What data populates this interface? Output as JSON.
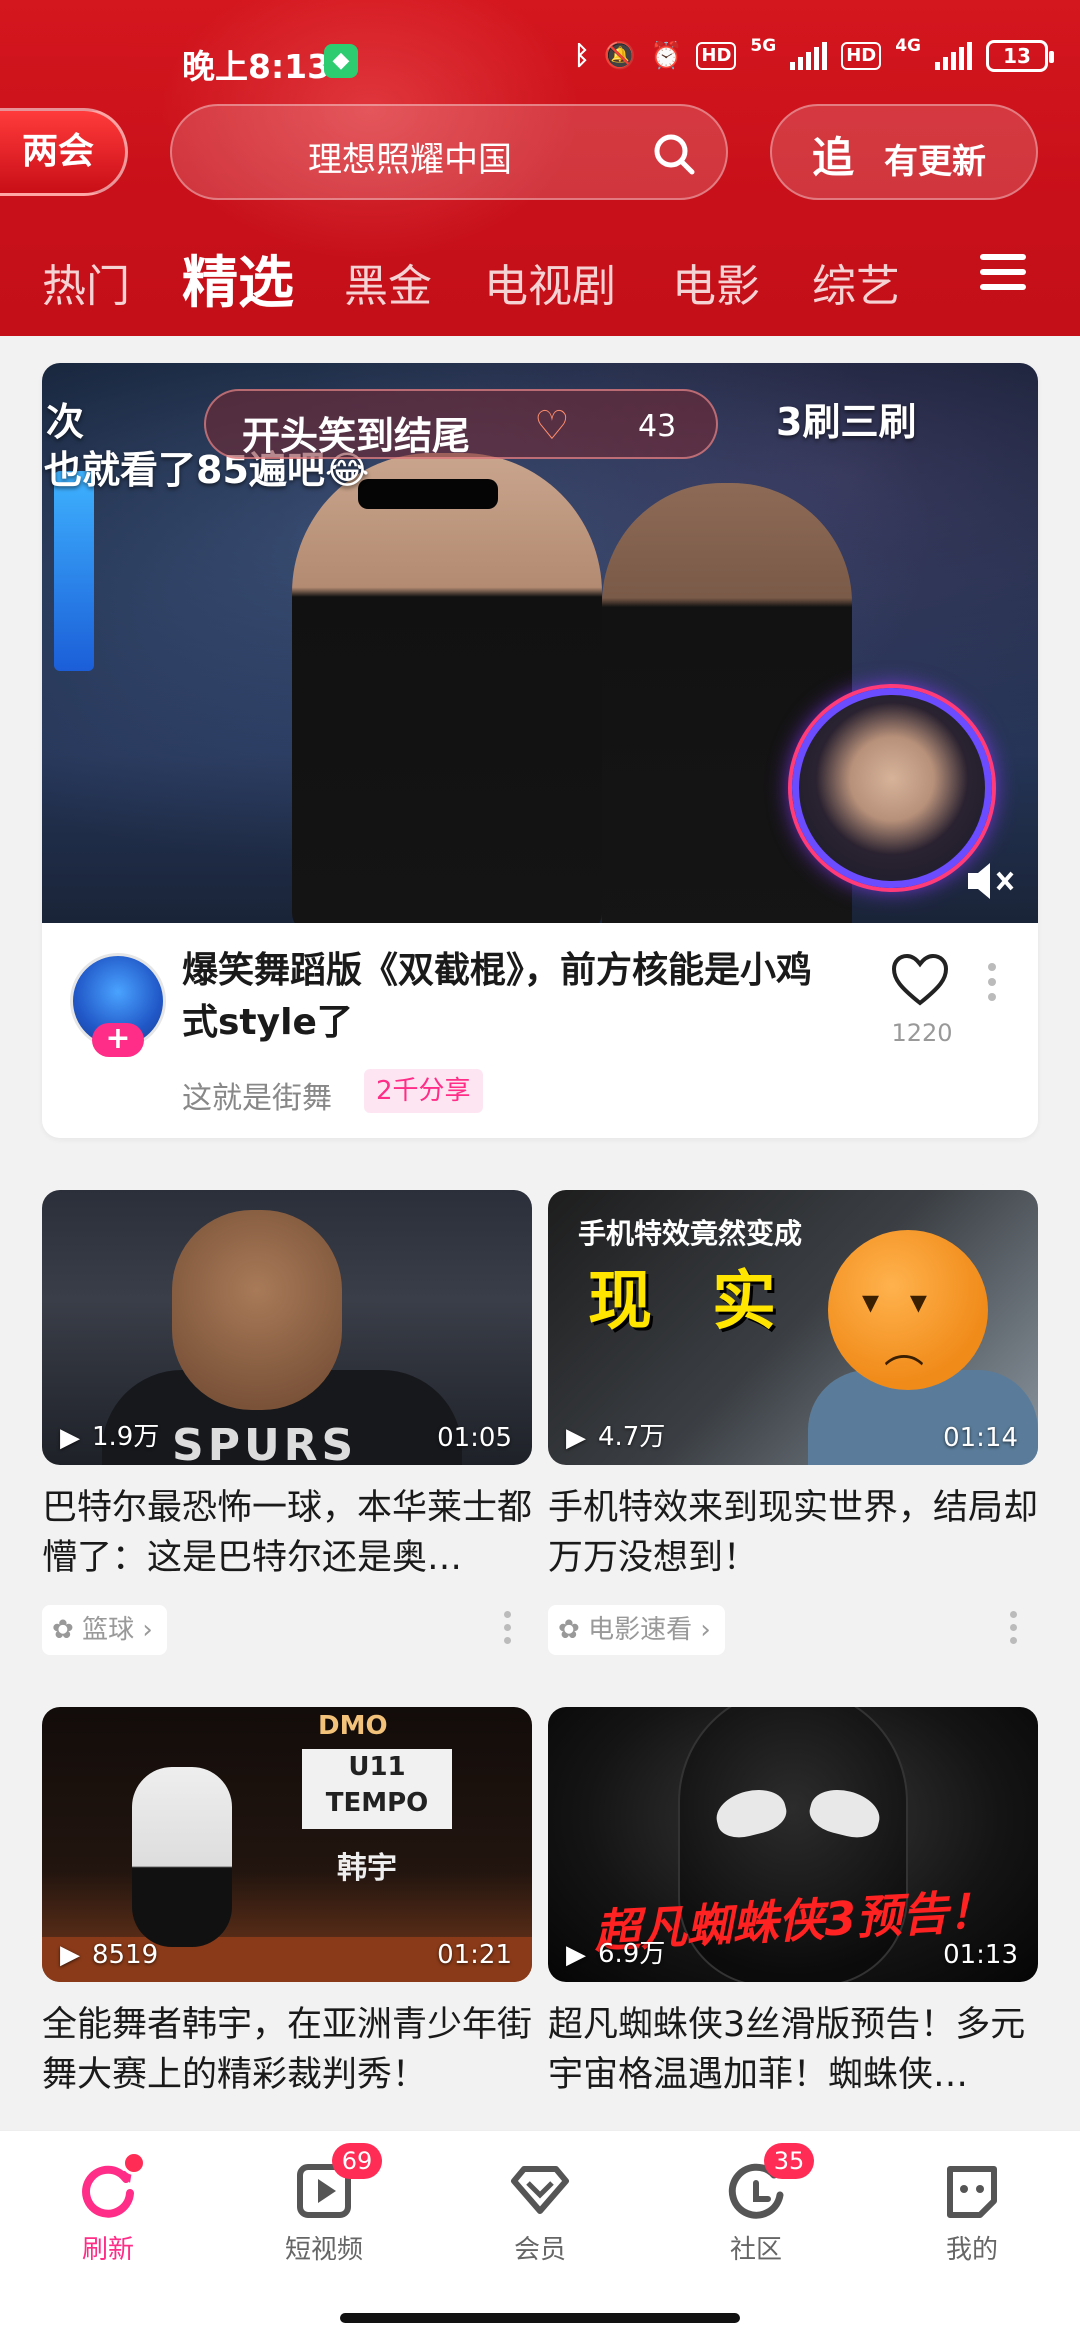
{
  "status_bar": {
    "time": "晚上8:13",
    "battery": "13",
    "hd1": "HD",
    "hd2": "HD",
    "net1": "5G",
    "net2": "4G"
  },
  "header": {
    "badge_label": "两会",
    "search_placeholder": "理想照耀中国",
    "follow_icon_text": "追",
    "follow_label": "有更新",
    "tabs": [
      "热门",
      "精选",
      "黑金",
      "电视剧",
      "电影",
      "综艺"
    ],
    "active_tab": "精选",
    "colors": {
      "header_bg": "#c8101a",
      "accent": "#ff2d87"
    }
  },
  "featured": {
    "video_caption_left": "次",
    "video_caption_line": "也就看了85遍吧😂",
    "pill_text": "开头笑到结尾",
    "pill_count": "43",
    "video_caption_right": "3刷三刷",
    "title": "爆笑舞蹈版《双截棍》，前方核能是小鸡式style了",
    "source": "这就是街舞",
    "share_tag": "2千分享",
    "likes": "1220"
  },
  "cards": [
    {
      "views": "1.9万",
      "duration": "01:05",
      "title": "巴特尔最恐怖一球，本华莱士都懵了：这是巴特尔还是奥…",
      "tag": "篮球",
      "thumb_text": "SPURS"
    },
    {
      "views": "4.7万",
      "duration": "01:14",
      "title": "手机特效来到现实世界，结局却万万没想到！",
      "tag": "电影速看",
      "thumb_line1": "手机特效竟然变成",
      "thumb_line2": "现实"
    },
    {
      "views": "8519",
      "duration": "01:21",
      "title": "全能舞者韩宇，在亚洲青少年街舞大赛上的精彩裁判秀！",
      "thumb_brand": "DMO",
      "thumb_board": "U11 TEMPO",
      "thumb_name": "韩宇"
    },
    {
      "views": "6.9万",
      "duration": "01:13",
      "title": "超凡蜘蛛侠3丝滑版预告！多元宇宙格温遇加菲！蜘蛛侠…",
      "thumb_text": "超凡蜘蛛侠3预告！"
    }
  ],
  "bottom_nav": [
    {
      "label": "刷新",
      "active": true,
      "dot": true
    },
    {
      "label": "短视频",
      "badge": "69"
    },
    {
      "label": "会员"
    },
    {
      "label": "社区",
      "badge": "35"
    },
    {
      "label": "我的"
    }
  ]
}
